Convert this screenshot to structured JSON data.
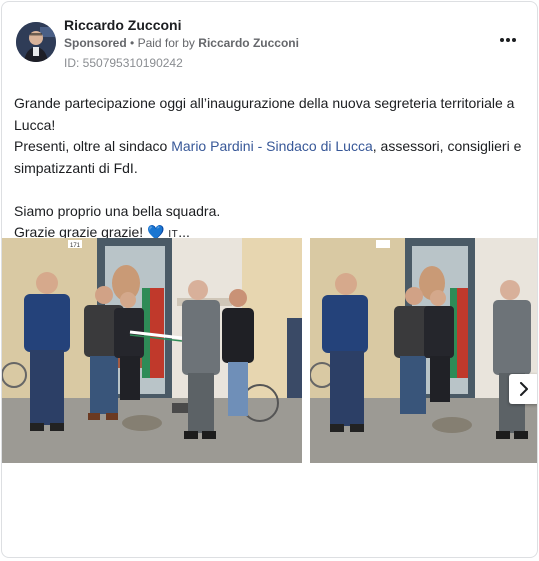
{
  "post": {
    "author": "Riccardo Zucconi",
    "sponsored_label": "Sponsored",
    "separator": "•",
    "paid_for_prefix": "Paid for by",
    "paid_for_name": "Riccardo Zucconi",
    "ad_id": "ID: 550795310190242",
    "more_icon": "more-horizontal-icon"
  },
  "body": {
    "line1": "Grande partecipazione oggi all’inaugurazione della nuova segreteria territoriale a Lucca!",
    "line2_prefix": "Presenti, oltre al sindaco ",
    "line2_mention": "Mario Pardini - Sindaco di Lucca",
    "line2_suffix": ", assessori, consiglieri e simpatizzanti di FdI.",
    "line3": "Siamo proprio una bella squadra.",
    "line4": "Grazie grazie grazie!",
    "heart": "💙",
    "flag_text": "IT",
    "ellipsis": "..."
  },
  "carousel": {
    "next_icon": "chevron-right-icon",
    "photos": [
      {
        "description_icon": "photo-ribbon-cutting"
      },
      {
        "description_icon": "photo-ribbon-cut"
      }
    ],
    "door_number": "171"
  },
  "colors": {
    "mention": "#385898",
    "heart": "#3b8bd6",
    "meta": "#65676b"
  }
}
